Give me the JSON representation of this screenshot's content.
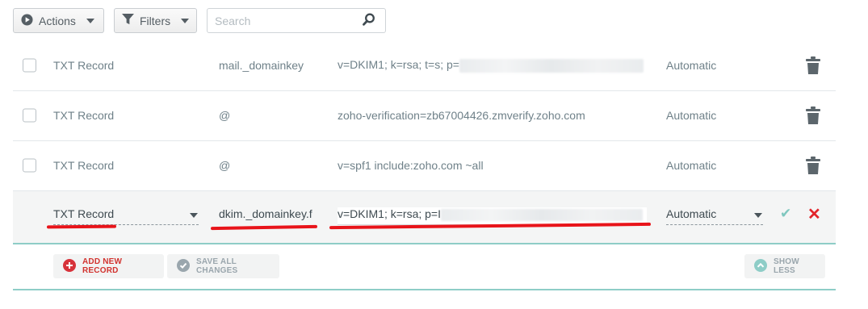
{
  "toolbar": {
    "actions_label": "Actions",
    "filters_label": "Filters",
    "search_placeholder": "Search"
  },
  "records": [
    {
      "type": "TXT Record",
      "host": "mail._domainkey",
      "value": "v=DKIM1; k=rsa; t=s; p=",
      "value_redacted": true,
      "ttl": "Automatic"
    },
    {
      "type": "TXT Record",
      "host": "@",
      "value": "zoho-verification=zb67004426.zmverify.zoho.com",
      "value_redacted": false,
      "ttl": "Automatic"
    },
    {
      "type": "TXT Record",
      "host": "@",
      "value": "v=spf1 include:zoho.com ~all",
      "value_redacted": false,
      "ttl": "Automatic"
    }
  ],
  "edit_row": {
    "type": "TXT Record",
    "host": "dkim._domainkey.f",
    "value": "v=DKIM1; k=rsa; p=I",
    "ttl": "Automatic",
    "confirm_icon": "check-icon",
    "cancel_icon": "close-icon",
    "highlight_color": "#e8141a"
  },
  "footer": {
    "add_label": "ADD NEW RECORD",
    "save_label": "SAVE ALL CHANGES",
    "show_less_label": "SHOW LESS"
  },
  "colors": {
    "accent": "#8ecdc7",
    "danger": "#e2252b",
    "text": "#6f8189"
  }
}
